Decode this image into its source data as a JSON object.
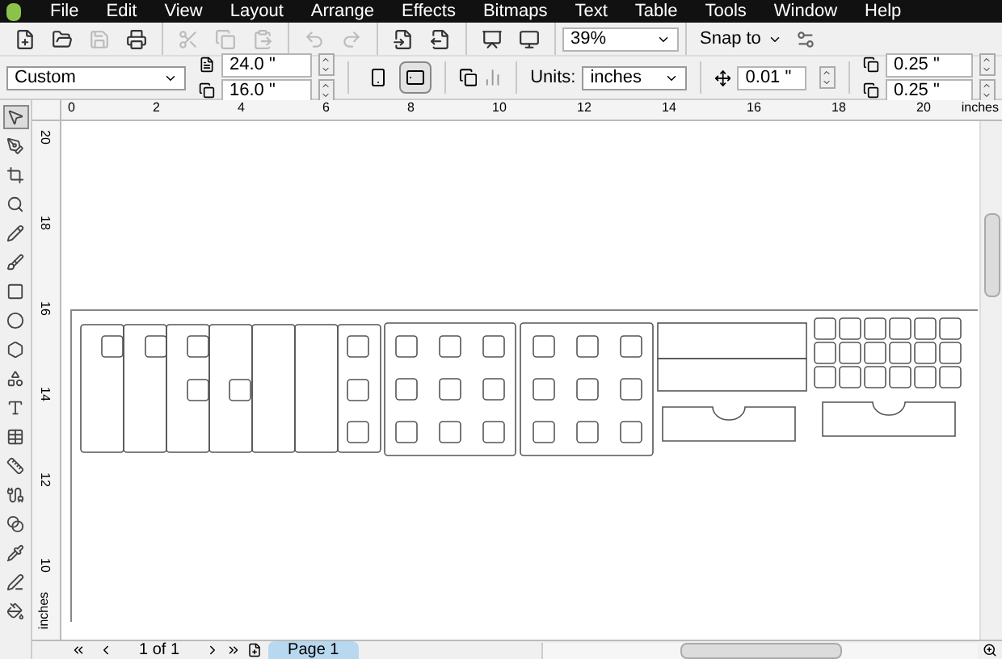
{
  "menu_bar": {
    "items": [
      "File",
      "Edit",
      "View",
      "Layout",
      "Arrange",
      "Effects",
      "Bitmaps",
      "Text",
      "Table",
      "Tools",
      "Window",
      "Help"
    ]
  },
  "standard_toolbar": {
    "buttons": [
      {
        "kind": "new",
        "disabled": false
      },
      {
        "kind": "open",
        "disabled": false
      },
      {
        "kind": "save",
        "disabled": true
      },
      {
        "kind": "print",
        "disabled": false
      },
      {
        "kind": "cut",
        "disabled": true
      },
      {
        "kind": "copy",
        "disabled": true
      },
      {
        "kind": "paste",
        "disabled": true
      },
      {
        "kind": "undo",
        "disabled": true
      },
      {
        "kind": "redo",
        "disabled": true
      },
      {
        "kind": "import",
        "disabled": false
      },
      {
        "kind": "export",
        "disabled": false
      },
      {
        "kind": "publish",
        "disabled": false
      },
      {
        "kind": "present",
        "disabled": false
      }
    ],
    "zoom": "39%",
    "snap": "Snap to"
  },
  "property_bar": {
    "page_preset": "Custom",
    "width": "24.0 \"",
    "height": "16.0 \"",
    "orientation": [
      {
        "kind": "portrait",
        "selected": false
      },
      {
        "kind": "landscape",
        "selected": true
      }
    ],
    "units_label": "Units:",
    "units": "inches",
    "nudge": "0.01 \"",
    "duplicate_x": "0.25 \"",
    "duplicate_y": "0.25 \""
  },
  "toolbox": [
    {
      "kind": "pick",
      "selected": true
    },
    {
      "kind": "shape",
      "selected": false
    },
    {
      "kind": "crop",
      "selected": false
    },
    {
      "kind": "zoom",
      "selected": false
    },
    {
      "kind": "freehand",
      "selected": false
    },
    {
      "kind": "smart",
      "selected": false
    },
    {
      "kind": "rectangle",
      "selected": false
    },
    {
      "kind": "ellipse",
      "selected": false
    },
    {
      "kind": "polygon",
      "selected": false
    },
    {
      "kind": "shapes",
      "selected": false
    },
    {
      "kind": "text",
      "selected": false
    },
    {
      "kind": "table",
      "selected": false
    },
    {
      "kind": "dimension",
      "selected": false
    },
    {
      "kind": "connector",
      "selected": false
    },
    {
      "kind": "blend",
      "selected": false
    },
    {
      "kind": "eyedropper",
      "selected": false
    },
    {
      "kind": "outline",
      "selected": false
    },
    {
      "kind": "fill",
      "selected": false
    }
  ],
  "horizontal_ruler": {
    "labels": [
      "0",
      "2",
      "4",
      "6",
      "8",
      "10",
      "12",
      "14",
      "16",
      "18",
      "20"
    ],
    "unit": "inches"
  },
  "vertical_ruler": {
    "labels": [
      "20",
      "18",
      "16",
      "14",
      "12",
      "10"
    ],
    "unit": "inches"
  },
  "page_navigator": {
    "count": "1 of 1",
    "tabs": [
      {
        "label": "Page 1",
        "selected": true
      }
    ]
  }
}
